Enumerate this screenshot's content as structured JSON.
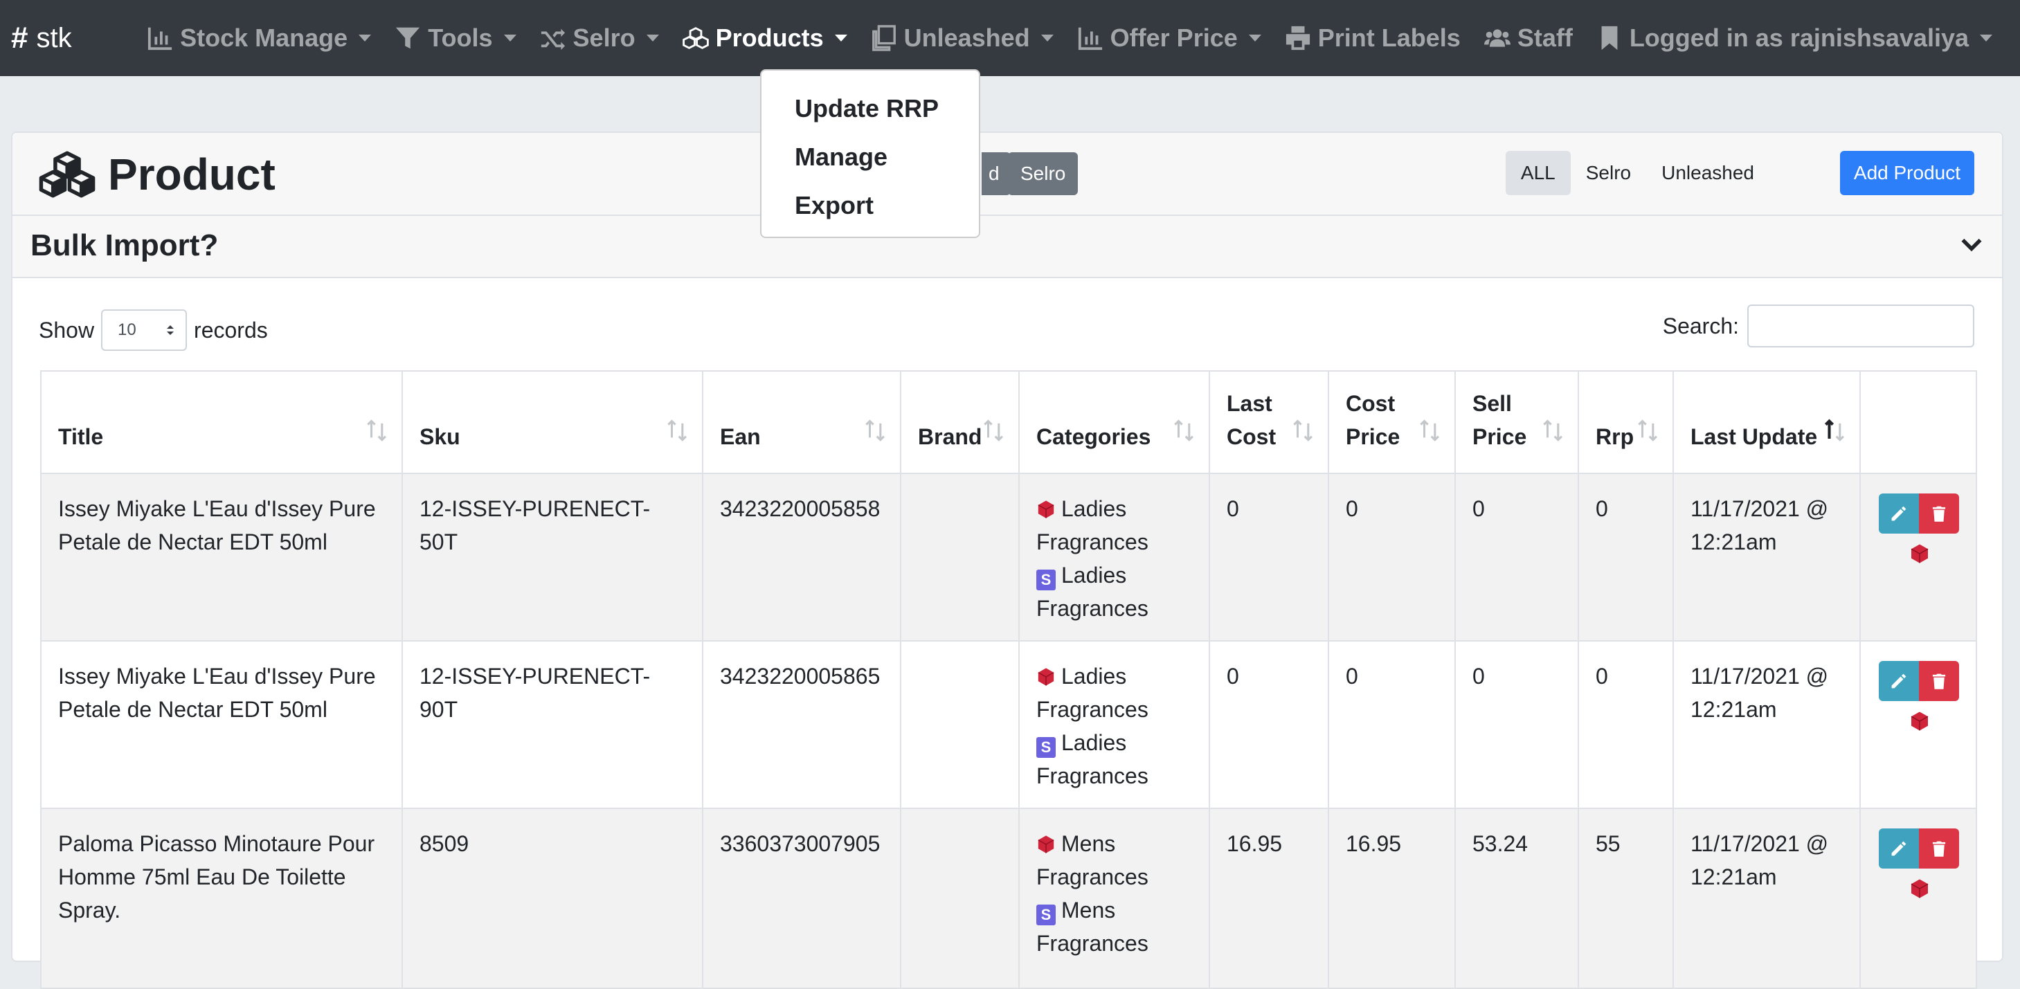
{
  "brand": {
    "label": "stk"
  },
  "nav": {
    "items": [
      {
        "label": "Stock Manage",
        "icon": "bar-chart-icon",
        "caret": true
      },
      {
        "label": "Tools",
        "icon": "filter-icon",
        "caret": true
      },
      {
        "label": "Selro",
        "icon": "shuffle-icon",
        "caret": true
      },
      {
        "label": "Products",
        "icon": "cubes-icon",
        "caret": true,
        "active": true
      },
      {
        "label": "Unleashed",
        "icon": "copy-icon",
        "caret": true
      },
      {
        "label": "Offer Price",
        "icon": "bar-chart-icon",
        "caret": true
      },
      {
        "label": "Print Labels",
        "icon": "print-icon",
        "caret": false
      },
      {
        "label": "Staff",
        "icon": "users-icon",
        "caret": false
      },
      {
        "label": "Logged in as rajnishsavaliya",
        "icon": "bookmark-icon",
        "caret": true
      }
    ]
  },
  "dropdown": {
    "items": [
      "Update RRP",
      "Manage",
      "Export"
    ]
  },
  "header": {
    "title": "Product",
    "partial_button": "d",
    "selro_button": "Selro",
    "filters": [
      "ALL",
      "Selro",
      "Unleashed"
    ],
    "add_button": "Add Product"
  },
  "bulk": {
    "title": "Bulk Import?"
  },
  "controls": {
    "show_label": "Show",
    "records_label": "records",
    "page_size": "10",
    "search_label": "Search:"
  },
  "table": {
    "columns": [
      "Title",
      "Sku",
      "Ean",
      "Brand",
      "Categories",
      "Last Cost",
      "Cost Price",
      "Sell Price",
      "Rrp",
      "Last Update"
    ],
    "rows": [
      {
        "title": "Issey Miyake L'Eau d'Issey Pure Petale de Nectar EDT 50ml",
        "sku": "12-ISSEY-PURENECT-50T",
        "ean": "3423220005858",
        "brand": "",
        "categories": [
          "Ladies Fragrances",
          "Ladies Fragrances"
        ],
        "last_cost": "0",
        "cost_price": "0",
        "sell_price": "0",
        "rrp": "0",
        "last_update": "11/17/2021 @ 12:21am"
      },
      {
        "title": "Issey Miyake L'Eau d'Issey Pure Petale de Nectar EDT 50ml",
        "sku": "12-ISSEY-PURENECT-90T",
        "ean": "3423220005865",
        "brand": "",
        "categories": [
          "Ladies Fragrances",
          "Ladies Fragrances"
        ],
        "last_cost": "0",
        "cost_price": "0",
        "sell_price": "0",
        "rrp": "0",
        "last_update": "11/17/2021 @ 12:21am"
      },
      {
        "title": "Paloma Picasso Minotaure Pour Homme 75ml Eau De Toilette Spray.",
        "sku": "8509",
        "ean": "3360373007905",
        "brand": "",
        "categories": [
          "Mens Fragrances",
          "Mens Fragrances"
        ],
        "last_cost": "16.95",
        "cost_price": "16.95",
        "sell_price": "53.24",
        "rrp": "55",
        "last_update": "11/17/2021 @ 12:21am"
      }
    ]
  },
  "colors": {
    "navbar": "#343a40",
    "primary": "#2d7ff9",
    "info": "#3fa3bf",
    "danger": "#dc3545",
    "selro_badge": "#6b62e0",
    "unleashed_cube": "#d0243a"
  },
  "badges": {
    "selro": "S"
  }
}
